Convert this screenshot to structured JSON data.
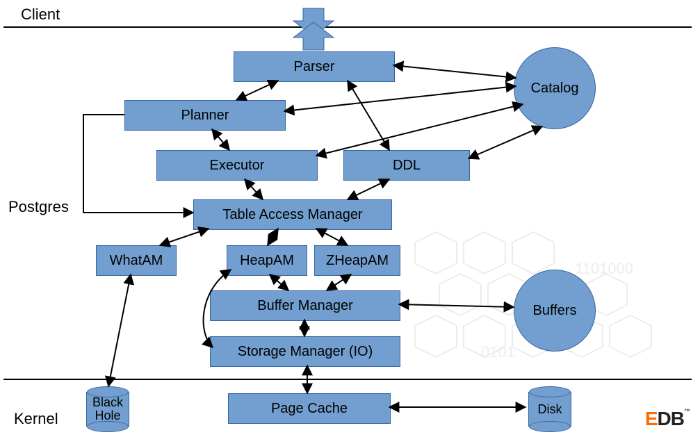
{
  "sections": {
    "client": "Client",
    "postgres": "Postgres",
    "kernel": "Kernel"
  },
  "nodes": {
    "parser": "Parser",
    "catalog": "Catalog",
    "planner": "Planner",
    "executor": "Executor",
    "ddl": "DDL",
    "tam": "Table Access Manager",
    "whatam": "WhatAM",
    "heapam": "HeapAM",
    "zheapam": "ZHeapAM",
    "bufmgr": "Buffer Manager",
    "buffers": "Buffers",
    "smgr": "Storage Manager (IO)",
    "pagecache": "Page Cache",
    "blackhole": "Black\nHole",
    "disk": "Disk"
  },
  "brand": {
    "e": "E",
    "db": "DB",
    "tm": "™"
  },
  "colors": {
    "box_fill": "#729fcf",
    "box_stroke": "#3465a4",
    "arrow": "#000000"
  },
  "chart_data": {
    "type": "flow-diagram",
    "layers": [
      "Client",
      "Postgres",
      "Kernel"
    ],
    "nodes": [
      {
        "id": "parser",
        "label": "Parser",
        "layer": "Postgres",
        "shape": "rect"
      },
      {
        "id": "catalog",
        "label": "Catalog",
        "layer": "Postgres",
        "shape": "circle"
      },
      {
        "id": "planner",
        "label": "Planner",
        "layer": "Postgres",
        "shape": "rect"
      },
      {
        "id": "executor",
        "label": "Executor",
        "layer": "Postgres",
        "shape": "rect"
      },
      {
        "id": "ddl",
        "label": "DDL",
        "layer": "Postgres",
        "shape": "rect"
      },
      {
        "id": "tam",
        "label": "Table Access Manager",
        "layer": "Postgres",
        "shape": "rect"
      },
      {
        "id": "whatam",
        "label": "WhatAM",
        "layer": "Postgres",
        "shape": "rect"
      },
      {
        "id": "heapam",
        "label": "HeapAM",
        "layer": "Postgres",
        "shape": "rect"
      },
      {
        "id": "zheapam",
        "label": "ZHeapAM",
        "layer": "Postgres",
        "shape": "rect"
      },
      {
        "id": "bufmgr",
        "label": "Buffer Manager",
        "layer": "Postgres",
        "shape": "rect"
      },
      {
        "id": "buffers",
        "label": "Buffers",
        "layer": "Postgres",
        "shape": "circle"
      },
      {
        "id": "smgr",
        "label": "Storage Manager (IO)",
        "layer": "Postgres",
        "shape": "rect"
      },
      {
        "id": "pagecache",
        "label": "Page Cache",
        "layer": "Kernel",
        "shape": "rect"
      },
      {
        "id": "blackhole",
        "label": "Black Hole",
        "layer": "Kernel",
        "shape": "cylinder"
      },
      {
        "id": "disk",
        "label": "Disk",
        "layer": "Kernel",
        "shape": "cylinder"
      }
    ],
    "edges": [
      {
        "from": "client",
        "to": "parser",
        "dir": "both"
      },
      {
        "from": "parser",
        "to": "planner",
        "dir": "both"
      },
      {
        "from": "parser",
        "to": "ddl",
        "dir": "both"
      },
      {
        "from": "parser",
        "to": "catalog",
        "dir": "both"
      },
      {
        "from": "planner",
        "to": "executor",
        "dir": "both"
      },
      {
        "from": "planner",
        "to": "catalog",
        "dir": "both"
      },
      {
        "from": "planner",
        "to": "tam",
        "dir": "forward",
        "note": "via left route"
      },
      {
        "from": "executor",
        "to": "tam",
        "dir": "both"
      },
      {
        "from": "executor",
        "to": "catalog",
        "dir": "both"
      },
      {
        "from": "ddl",
        "to": "tam",
        "dir": "both"
      },
      {
        "from": "ddl",
        "to": "catalog",
        "dir": "both"
      },
      {
        "from": "tam",
        "to": "whatam",
        "dir": "both"
      },
      {
        "from": "tam",
        "to": "heapam",
        "dir": "both"
      },
      {
        "from": "tam",
        "to": "zheapam",
        "dir": "both"
      },
      {
        "from": "heapam",
        "to": "bufmgr",
        "dir": "both"
      },
      {
        "from": "zheapam",
        "to": "bufmgr",
        "dir": "both"
      },
      {
        "from": "heapam",
        "to": "smgr",
        "dir": "both",
        "note": "curved left bypass"
      },
      {
        "from": "bufmgr",
        "to": "buffers",
        "dir": "both"
      },
      {
        "from": "bufmgr",
        "to": "smgr",
        "dir": "both"
      },
      {
        "from": "smgr",
        "to": "pagecache",
        "dir": "both"
      },
      {
        "from": "whatam",
        "to": "blackhole",
        "dir": "both"
      },
      {
        "from": "pagecache",
        "to": "disk",
        "dir": "both"
      }
    ]
  }
}
